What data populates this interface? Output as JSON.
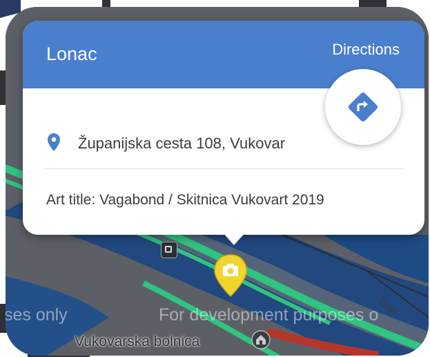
{
  "popup": {
    "title": "Lonac",
    "directions_label": "Directions",
    "address": "Županijska cesta 108, Vukovar",
    "art_title": "Art title: Vagabond / Skitnica Vukovart 2019"
  },
  "map": {
    "watermark_left": "ses only",
    "watermark_right": "For development purposes o",
    "road_label": "Vukovarska bolnica"
  },
  "colors": {
    "header": "#4a7fcd",
    "water": "#21487f",
    "road_green": "#2fc47f",
    "camera_pin": "#f1d52c"
  },
  "icons": {
    "fab": "directions-icon",
    "address": "location-pin-icon",
    "marker": "camera-icon",
    "poi": "hospital-icon"
  }
}
